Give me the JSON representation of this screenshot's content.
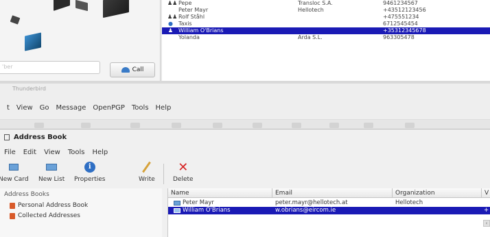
{
  "phone_app": {
    "number_placeholder": "'ber",
    "call_label": "Call",
    "contacts": [
      {
        "icon": "group",
        "name": "Pepe",
        "org": "Transloc S.A.",
        "phone": "9461234567"
      },
      {
        "icon": "none",
        "name": "Peter Mayr",
        "org": "Hellotech",
        "phone": "+43512123456"
      },
      {
        "icon": "group",
        "name": "Rolf Ståhl",
        "org": "",
        "phone": "+475551234"
      },
      {
        "icon": "globe",
        "name": "Taxis",
        "org": "",
        "phone": "6712545454"
      },
      {
        "icon": "person",
        "name": "William O'Brians",
        "org": "",
        "phone": "+35312345678",
        "selected": true
      },
      {
        "icon": "none",
        "name": "Yolanda",
        "org": "Arda S.L.",
        "phone": "963305478"
      }
    ]
  },
  "thunderbird": {
    "title": "Thunderbird",
    "menu": [
      "t",
      "View",
      "Go",
      "Message",
      "OpenPGP",
      "Tools",
      "Help"
    ]
  },
  "address_book": {
    "title": "Address Book",
    "menu": [
      "File",
      "Edit",
      "View",
      "Tools",
      "Help"
    ],
    "toolbar": {
      "new_card": "New Card",
      "new_list": "New List",
      "properties": "Properties",
      "write": "Write",
      "delete": "Delete"
    },
    "sidebar": {
      "header": "Address Books",
      "items": [
        "Personal Address Book",
        "Collected Addresses"
      ]
    },
    "columns": {
      "name": "Name",
      "email": "Email",
      "organization": "Organization",
      "extra": "V"
    },
    "rows": [
      {
        "name": "Peter Mayr",
        "email": "peter.mayr@hellotech.at",
        "org": "Hellotech",
        "extra": "",
        "selected": false
      },
      {
        "name": "William O'Brians",
        "email": "w.obrians@eircom.ie",
        "org": "",
        "extra": "+",
        "selected": true
      }
    ]
  },
  "colors": {
    "selection": "#1a1ab5",
    "delete_icon": "#d62323",
    "properties_icon": "#2f6fc4"
  }
}
